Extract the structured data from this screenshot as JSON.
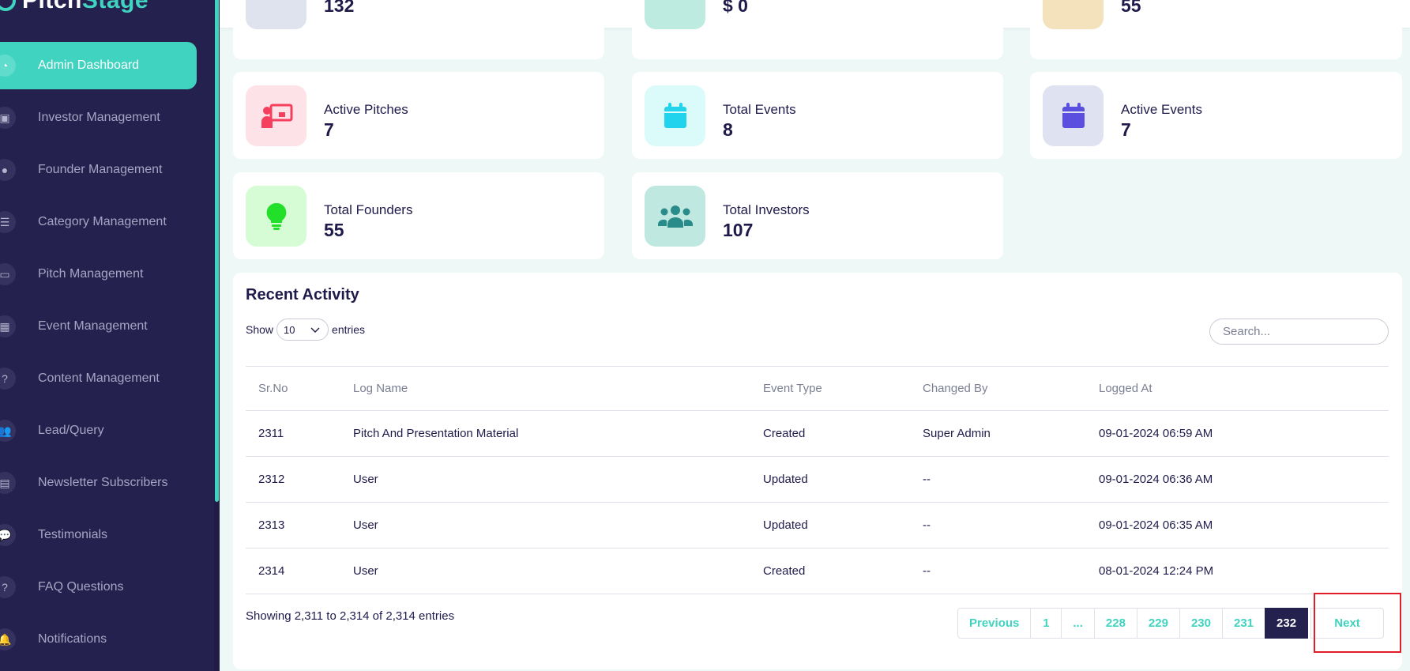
{
  "brand": {
    "name_main": "Pitch",
    "name_accent": "Stage"
  },
  "sidebar": {
    "items": [
      {
        "label": "Admin Dashboard",
        "icon": "gauge-icon",
        "glyph": "◔",
        "active": true
      },
      {
        "label": "Investor Management",
        "icon": "contact-book-icon",
        "glyph": "▣"
      },
      {
        "label": "Founder Management",
        "icon": "lightbulb-icon",
        "glyph": "●"
      },
      {
        "label": "Category Management",
        "icon": "list-icon",
        "glyph": "☰"
      },
      {
        "label": "Pitch Management",
        "icon": "presentation-icon",
        "glyph": "▭"
      },
      {
        "label": "Event Management",
        "icon": "calendar-icon",
        "glyph": "▦"
      },
      {
        "label": "Content Management",
        "icon": "question-icon",
        "glyph": "?"
      },
      {
        "label": "Lead/Query",
        "icon": "users-icon",
        "glyph": "👥"
      },
      {
        "label": "Newsletter Subscribers",
        "icon": "newspaper-icon",
        "glyph": "▤"
      },
      {
        "label": "Testimonials",
        "icon": "comments-icon",
        "glyph": "💬"
      },
      {
        "label": "FAQ Questions",
        "icon": "question-icon",
        "glyph": "?"
      },
      {
        "label": "Notifications",
        "icon": "bell-icon",
        "glyph": "🔔"
      }
    ]
  },
  "stats": {
    "top_partial": [
      {
        "value": "132",
        "icon": "users-icon",
        "bg": "#dfe3ee"
      },
      {
        "value": "$ 0",
        "icon": "dollar-icon",
        "bg": "#bdebe0"
      },
      {
        "value": "55",
        "icon": "star-icon",
        "bg": "#f3e2bc"
      }
    ],
    "cards": [
      {
        "label": "Active Pitches",
        "value": "7",
        "icon": "presentation-icon",
        "bg": "#fde2e7",
        "fg": "#f43f5e"
      },
      {
        "label": "Total Events",
        "value": "8",
        "icon": "calendar-icon",
        "bg": "#dbfbfb",
        "fg": "#22d3ee"
      },
      {
        "label": "Active Events",
        "value": "7",
        "icon": "calendar-icon",
        "bg": "#dfe2f0",
        "fg": "#5b4fe0"
      },
      {
        "label": "Total Founders",
        "value": "55",
        "icon": "lightbulb-icon",
        "bg": "#d6fcd6",
        "fg": "#22e02a"
      },
      {
        "label": "Total Investors",
        "value": "107",
        "icon": "users-icon",
        "bg": "#bfe9e0",
        "fg": "#2a8c8a"
      }
    ]
  },
  "activity": {
    "title": "Recent Activity",
    "show_label": "Show",
    "entries_label": "entries",
    "page_length": "10",
    "search_placeholder": "Search...",
    "columns": [
      "Sr.No",
      "Log Name",
      "Event Type",
      "Changed By",
      "Logged At"
    ],
    "rows": [
      [
        "2311",
        "Pitch And Presentation Material",
        "Created",
        "Super Admin",
        "09-01-2024 06:59 AM"
      ],
      [
        "2312",
        "User",
        "Updated",
        "--",
        "09-01-2024 06:36 AM"
      ],
      [
        "2313",
        "User",
        "Updated",
        "--",
        "09-01-2024 06:35 AM"
      ],
      [
        "2314",
        "User",
        "Created",
        "--",
        "08-01-2024 12:24 PM"
      ]
    ],
    "info": "Showing 2,311 to 2,314 of 2,314 entries",
    "pagination": {
      "previous": "Previous",
      "pages": [
        "1",
        "...",
        "228",
        "229",
        "230",
        "231",
        "232"
      ],
      "current": "232",
      "next": "Next"
    }
  },
  "colors": {
    "accent": "#40d3c0",
    "sidebar": "#25214f",
    "highlight": "#e11d2a"
  }
}
